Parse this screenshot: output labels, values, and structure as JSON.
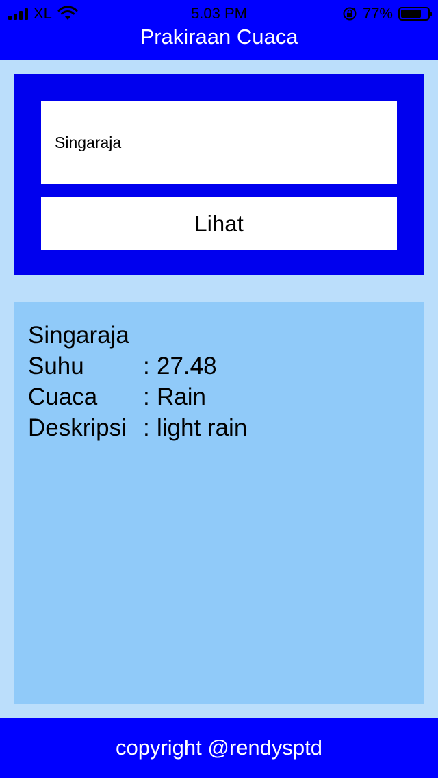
{
  "status_bar": {
    "carrier": "XL",
    "time": "5.03 PM",
    "battery_percent": "77%",
    "battery_level": 0.77
  },
  "header": {
    "title": "Prakiraan Cuaca"
  },
  "search": {
    "city_value": "Singaraja",
    "button_label": "Lihat"
  },
  "result": {
    "city": "Singaraja",
    "rows": [
      {
        "label": "Suhu",
        "separator": ":",
        "value": "27.48"
      },
      {
        "label": "Cuaca",
        "separator": ":",
        "value": "Rain"
      },
      {
        "label": "Deskripsi",
        "separator": ":",
        "value": "light rain"
      }
    ]
  },
  "footer": {
    "text": "copyright @rendysptd"
  },
  "colors": {
    "primary_blue": "#0000ff",
    "page_background": "#bbdefb",
    "result_background": "#90caf9"
  }
}
